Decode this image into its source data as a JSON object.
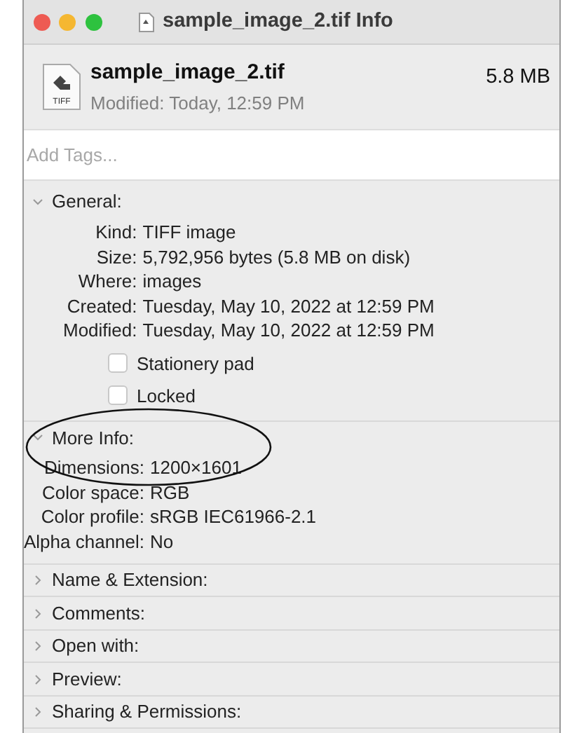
{
  "window": {
    "title": "sample_image_2.tif Info"
  },
  "file": {
    "name": "sample_image_2.tif",
    "size": "5.8 MB",
    "modified": "Modified: Today, 12:59 PM",
    "icon_label": "TIFF"
  },
  "tags": {
    "placeholder": "Add Tags..."
  },
  "sections": [
    {
      "title": "General:",
      "expanded": true,
      "fields": [
        {
          "label": "Kind:",
          "value": "TIFF image"
        },
        {
          "label": "Size:",
          "value": "5,792,956 bytes (5.8 MB on disk)"
        },
        {
          "label": "Where:",
          "value": "images"
        },
        {
          "label": "Created:",
          "value": "Tuesday, May 10, 2022 at 12:59 PM"
        },
        {
          "label": "Modified:",
          "value": "Tuesday, May 10, 2022 at 12:59 PM"
        }
      ],
      "checkboxes": [
        {
          "label": "Stationery pad",
          "checked": false
        },
        {
          "label": "Locked",
          "checked": false
        }
      ]
    },
    {
      "title": "More Info:",
      "expanded": true,
      "circled": true,
      "fields": [
        {
          "label": "Dimensions:",
          "value": "1200×1601"
        },
        {
          "label": "Color space:",
          "value": "RGB"
        },
        {
          "label": "Color profile:",
          "value": "sRGB IEC61966-2.1"
        },
        {
          "label": "Alpha channel:",
          "value": "No"
        }
      ]
    },
    {
      "title": "Name & Extension:",
      "expanded": false
    },
    {
      "title": "Comments:",
      "expanded": false
    },
    {
      "title": "Open with:",
      "expanded": false
    },
    {
      "title": "Preview:",
      "expanded": false
    },
    {
      "title": "Sharing & Permissions:",
      "expanded": false
    }
  ]
}
